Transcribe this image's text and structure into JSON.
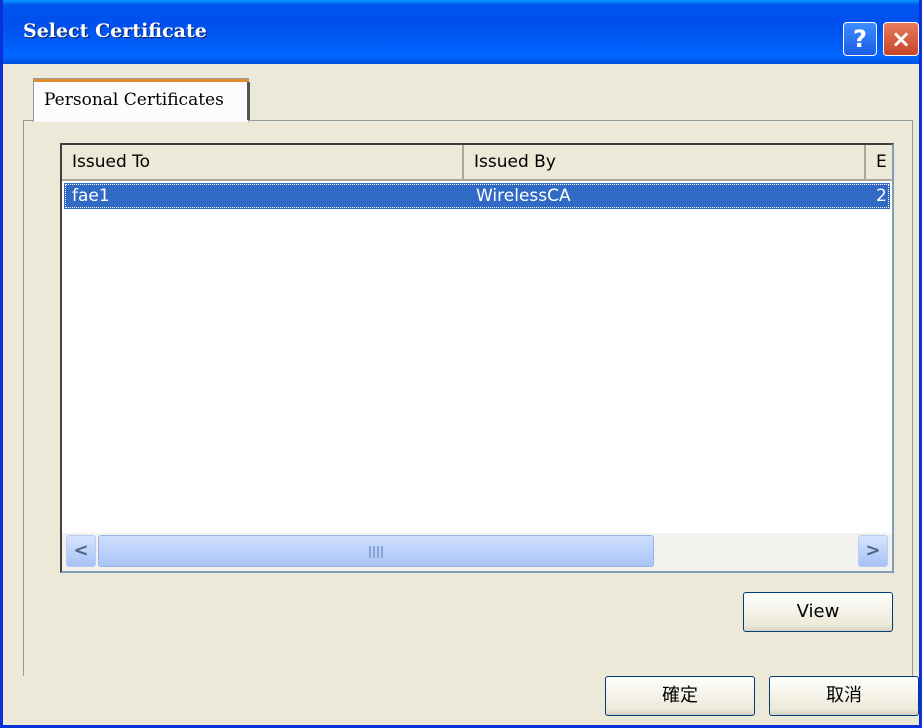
{
  "window": {
    "title": "Select Certificate"
  },
  "titlebar": {
    "help_label": "?",
    "close_label": "×"
  },
  "tabs": [
    {
      "label": "Personal Certificates"
    }
  ],
  "list": {
    "columns": [
      "Issued To",
      "Issued By",
      "E"
    ],
    "rows": [
      {
        "issued_to": "fae1",
        "issued_by": "WirelessCA",
        "expiry": "2",
        "selected": true
      }
    ]
  },
  "scrollbar": {
    "left_arrow": "<",
    "right_arrow": ">"
  },
  "buttons": {
    "view": "View",
    "ok": "確定",
    "cancel": "取消"
  },
  "colors": {
    "titlebar": "#0053ee",
    "selection": "#316ac5",
    "dialog_bg": "#ece9d8"
  }
}
